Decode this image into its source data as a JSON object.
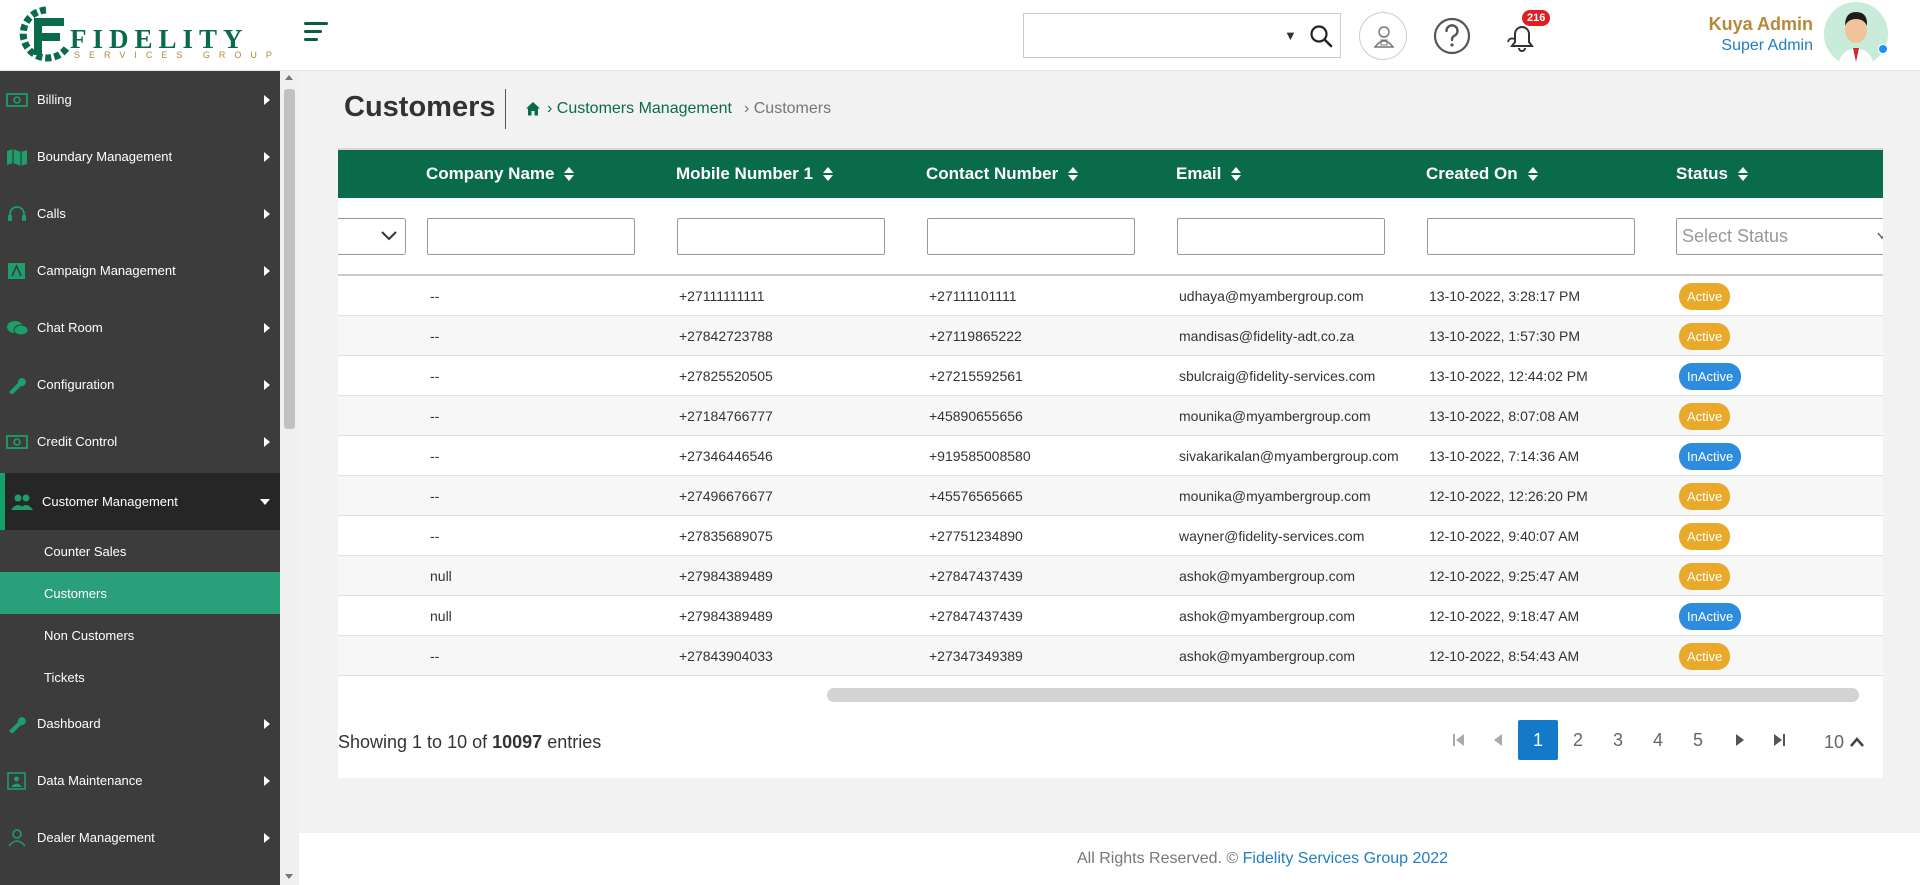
{
  "brand": {
    "logo_word": "FIDELITY",
    "logo_sub": "SERVICES GROUP",
    "primary_color": "#0a6b4b",
    "gold_color": "#b48a3a"
  },
  "header": {
    "search_placeholder": "",
    "notification_count": "216",
    "user_name": "Kuya Admin",
    "user_role": "Super Admin"
  },
  "sidebar": {
    "items": [
      {
        "label": "Billing",
        "icon": "money-icon"
      },
      {
        "label": "Boundary Management",
        "icon": "map-icon"
      },
      {
        "label": "Calls",
        "icon": "headset-icon"
      },
      {
        "label": "Campaign Management",
        "icon": "campaign-icon"
      },
      {
        "label": "Chat Room",
        "icon": "chat-icon"
      },
      {
        "label": "Configuration",
        "icon": "wrench-icon"
      },
      {
        "label": "Credit Control",
        "icon": "money-icon"
      },
      {
        "label": "Customer Management",
        "icon": "users-icon"
      },
      {
        "label": "Dashboard",
        "icon": "wrench-icon"
      },
      {
        "label": "Data Maintenance",
        "icon": "data-icon"
      },
      {
        "label": "Dealer Management",
        "icon": "user-icon"
      }
    ],
    "sub_items": [
      {
        "label": "Counter Sales"
      },
      {
        "label": "Customers"
      },
      {
        "label": "Non Customers"
      },
      {
        "label": "Tickets"
      }
    ]
  },
  "page": {
    "title": "Customers",
    "breadcrumb": [
      "› Customers Management",
      "› Customers"
    ]
  },
  "table": {
    "columns": [
      "Company Name",
      "Mobile Number 1",
      "Contact Number",
      "Email",
      "Created On",
      "Status"
    ],
    "status_placeholder": "Select Status",
    "rows": [
      {
        "company": "--",
        "mobile": "+27111111111",
        "contact": "+27111101111",
        "email": "udhaya@myambergroup.com",
        "created": "13-10-2022, 3:28:17 PM",
        "status": "Active"
      },
      {
        "company": "--",
        "mobile": "+27842723788",
        "contact": "+27119865222",
        "email": "mandisas@fidelity-adt.co.za",
        "created": "13-10-2022, 1:57:30 PM",
        "status": "Active"
      },
      {
        "company": "--",
        "mobile": "+27825520505",
        "contact": "+27215592561",
        "email": "sbulcraig@fidelity-services.com",
        "created": "13-10-2022, 12:44:02 PM",
        "status": "InActive"
      },
      {
        "company": "--",
        "mobile": "+27184766777",
        "contact": "+45890655656",
        "email": "mounika@myambergroup.com",
        "created": "13-10-2022, 8:07:08 AM",
        "status": "Active"
      },
      {
        "company": "--",
        "mobile": "+27346446546",
        "contact": "+919585008580",
        "email": "sivakarikalan@myambergroup.com",
        "created": "13-10-2022, 7:14:36 AM",
        "status": "InActive"
      },
      {
        "company": "--",
        "mobile": "+27496676677",
        "contact": "+45576565665",
        "email": "mounika@myambergroup.com",
        "created": "12-10-2022, 12:26:20 PM",
        "status": "Active"
      },
      {
        "company": "--",
        "mobile": "+27835689075",
        "contact": "+27751234890",
        "email": "wayner@fidelity-services.com",
        "created": "12-10-2022, 9:40:07 AM",
        "status": "Active"
      },
      {
        "company": "null",
        "mobile": "+27984389489",
        "contact": "+27847437439",
        "email": "ashok@myambergroup.com",
        "created": "12-10-2022, 9:25:47 AM",
        "status": "Active"
      },
      {
        "company": "null",
        "mobile": "+27984389489",
        "contact": "+27847437439",
        "email": "ashok@myambergroup.com",
        "created": "12-10-2022, 9:18:47 AM",
        "status": "InActive"
      },
      {
        "company": "--",
        "mobile": "+27843904033",
        "contact": "+27347349389",
        "email": "ashok@myambergroup.com",
        "created": "12-10-2022, 8:54:43 AM",
        "status": "Active"
      }
    ]
  },
  "pagination": {
    "showing_prefix": "Showing 1 to 10 of",
    "total": "10097",
    "showing_suffix": "entries",
    "pages": [
      "1",
      "2",
      "3",
      "4",
      "5"
    ],
    "current_page": "1",
    "page_size": "10"
  },
  "footer": {
    "text": "All Rights Reserved. ©",
    "link": "Fidelity Services Group 2022"
  }
}
